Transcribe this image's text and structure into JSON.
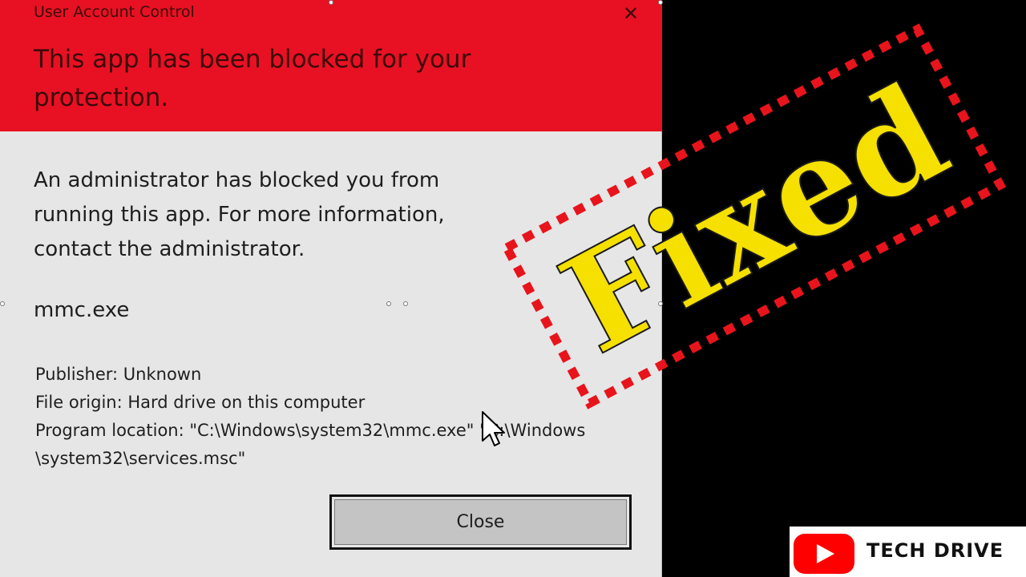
{
  "dialog": {
    "window_title": "User Account Control",
    "close_glyph": "✕",
    "headline": "This app has been blocked for your protection.",
    "message": "An administrator has blocked you from running this app. For more information, contact the administrator.",
    "app_name": "mmc.exe",
    "publisher": "Publisher: Unknown",
    "file_origin": "File origin: Hard drive on this computer",
    "program_location_line1": "Program location: \"C:\\Windows\\system32\\mmc.exe\" \"C:\\Windows",
    "program_location_line2": "\\system32\\services.msc\"",
    "close_button_label": "Close",
    "header_color": "#e81123"
  },
  "overlay": {
    "stamp_text": "Fixed",
    "stamp_color": "#f5e000",
    "stamp_border_color": "#e8141c"
  },
  "branding": {
    "channel_name": "TECH DRIVE",
    "icon": "youtube-play-icon",
    "icon_color": "#ff0000"
  }
}
